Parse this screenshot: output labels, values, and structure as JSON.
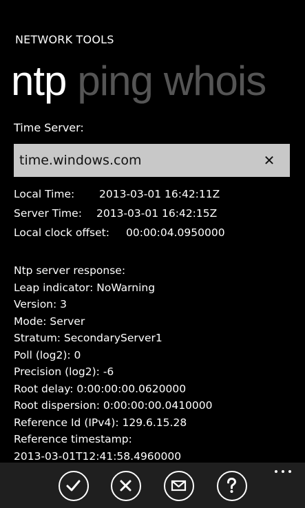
{
  "app": {
    "title": "NETWORK TOOLS"
  },
  "pivot": {
    "items": [
      {
        "label": "ntp",
        "active": true
      },
      {
        "label": "ping",
        "active": false
      },
      {
        "label": "whois",
        "active": false
      }
    ]
  },
  "time_server": {
    "label": "Time Server:",
    "value": "time.windows.com",
    "clear_icon": "close-icon"
  },
  "times": {
    "local_label": "Local Time:",
    "local_value": "2013-03-01 16:42:11Z",
    "server_label": "Server Time:",
    "server_value": "2013-03-01 16:42:15Z",
    "offset_label": "Local clock offset:",
    "offset_value": "00:00:04.0950000"
  },
  "response": {
    "lines": [
      "Ntp server response:",
      "Leap indicator: NoWarning",
      "Version: 3",
      "Mode: Server",
      "Stratum: SecondaryServer1",
      "Poll (log2): 0",
      "Precision (log2): -6",
      "Root delay: 0:00:00:00.0620000",
      "Root dispersion: 0:00:00:00.0410000",
      "Reference Id (IPv4): 129.6.15.28",
      "Reference timestamp:",
      "2013-03-01T12:41:58.4960000"
    ]
  },
  "appbar": {
    "buttons": [
      "check-icon",
      "cancel-icon",
      "mail-icon",
      "help-icon"
    ],
    "more": "more-dots-icon"
  }
}
